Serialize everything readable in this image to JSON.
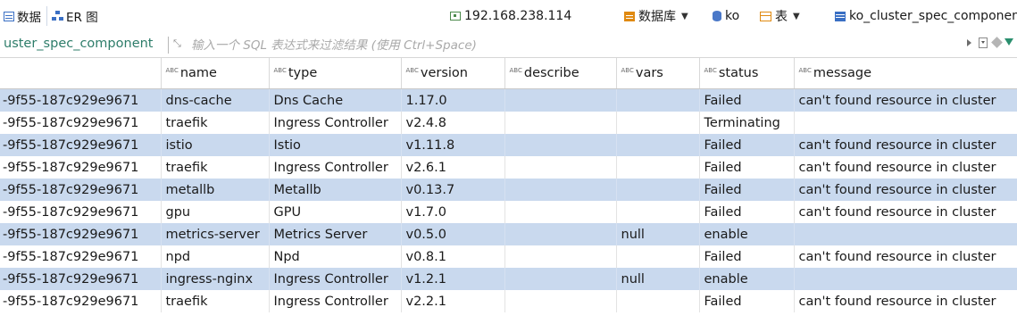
{
  "tabs": [
    {
      "label": "数据",
      "icon": "grid-icon"
    },
    {
      "label": "ER 图",
      "icon": "er-diagram-icon"
    }
  ],
  "connection": {
    "host": "192.168.238.114",
    "database_label": "数据库",
    "schema": "ko",
    "table_type_label": "表",
    "table": "ko_cluster_spec_componen"
  },
  "filter": {
    "table_name": "uster_spec_component",
    "placeholder": "输入一个 SQL 表达式来过滤结果 (使用 Ctrl+Space)"
  },
  "columns": [
    {
      "key": "id",
      "label": "",
      "abc": false
    },
    {
      "key": "name",
      "label": "name",
      "abc": true
    },
    {
      "key": "type",
      "label": "type",
      "abc": true
    },
    {
      "key": "version",
      "label": "version",
      "abc": true
    },
    {
      "key": "describe",
      "label": "describe",
      "abc": true
    },
    {
      "key": "vars",
      "label": "vars",
      "abc": true
    },
    {
      "key": "status",
      "label": "status",
      "abc": true
    },
    {
      "key": "message",
      "label": "message",
      "abc": true
    }
  ],
  "rows": [
    [
      "-9f55-187c929e9671",
      "dns-cache",
      "Dns Cache",
      "1.17.0",
      "",
      "",
      "Failed",
      "can't found resource in cluster"
    ],
    [
      "-9f55-187c929e9671",
      "traefik",
      "Ingress Controller",
      "v2.4.8",
      "",
      "",
      "Terminating",
      ""
    ],
    [
      "-9f55-187c929e9671",
      "istio",
      "Istio",
      "v1.11.8",
      "",
      "",
      "Failed",
      "can't found resource in cluster"
    ],
    [
      "-9f55-187c929e9671",
      "traefik",
      "Ingress Controller",
      "v2.6.1",
      "",
      "",
      "Failed",
      "can't found resource in cluster"
    ],
    [
      "-9f55-187c929e9671",
      "metallb",
      "Metallb",
      "v0.13.7",
      "",
      "",
      "Failed",
      "can't found resource in cluster"
    ],
    [
      "-9f55-187c929e9671",
      "gpu",
      "GPU",
      "v1.7.0",
      "",
      "",
      "Failed",
      "can't found resource in cluster"
    ],
    [
      "-9f55-187c929e9671",
      "metrics-server",
      "Metrics Server",
      "v0.5.0",
      "",
      "null",
      "enable",
      ""
    ],
    [
      "-9f55-187c929e9671",
      "npd",
      "Npd",
      "v0.8.1",
      "",
      "",
      "Failed",
      "can't found resource in cluster"
    ],
    [
      "-9f55-187c929e9671",
      "ingress-nginx",
      "Ingress Controller",
      "v1.2.1",
      "",
      "null",
      "enable",
      ""
    ],
    [
      "-9f55-187c929e9671",
      "traefik",
      "Ingress Controller",
      "v2.2.1",
      "",
      "",
      "Failed",
      "can't found resource in cluster"
    ]
  ]
}
